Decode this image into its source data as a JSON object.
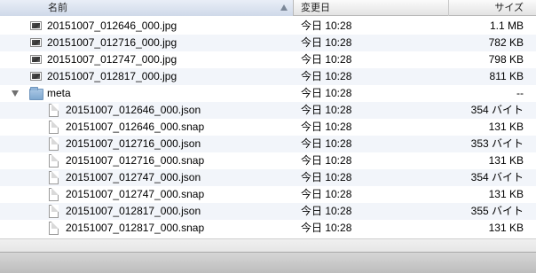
{
  "columns": {
    "name": "名前",
    "date": "変更日",
    "size": "サイズ"
  },
  "files": [
    {
      "name": "20151007_012646_000.jpg",
      "date": "今日 10:28",
      "size": "1.1 MB",
      "icon": "image-icon"
    },
    {
      "name": "20151007_012716_000.jpg",
      "date": "今日 10:28",
      "size": "782 KB",
      "icon": "image-icon"
    },
    {
      "name": "20151007_012747_000.jpg",
      "date": "今日 10:28",
      "size": "798 KB",
      "icon": "image-icon"
    },
    {
      "name": "20151007_012817_000.jpg",
      "date": "今日 10:28",
      "size": "811 KB",
      "icon": "image-icon"
    }
  ],
  "folder": {
    "name": "meta",
    "date": "今日 10:28",
    "size": "--",
    "icon": "folder-icon",
    "expanded": true
  },
  "meta_files": [
    {
      "name": "20151007_012646_000.json",
      "date": "今日 10:28",
      "size": "354 バイト",
      "icon": "document-icon"
    },
    {
      "name": "20151007_012646_000.snap",
      "date": "今日 10:28",
      "size": "131 KB",
      "icon": "document-icon"
    },
    {
      "name": "20151007_012716_000.json",
      "date": "今日 10:28",
      "size": "353 バイト",
      "icon": "document-icon"
    },
    {
      "name": "20151007_012716_000.snap",
      "date": "今日 10:28",
      "size": "131 KB",
      "icon": "document-icon"
    },
    {
      "name": "20151007_012747_000.json",
      "date": "今日 10:28",
      "size": "354 バイト",
      "icon": "document-icon"
    },
    {
      "name": "20151007_012747_000.snap",
      "date": "今日 10:28",
      "size": "131 KB",
      "icon": "document-icon"
    },
    {
      "name": "20151007_012817_000.json",
      "date": "今日 10:28",
      "size": "355 バイト",
      "icon": "document-icon"
    },
    {
      "name": "20151007_012817_000.snap",
      "date": "今日 10:28",
      "size": "131 KB",
      "icon": "document-icon"
    }
  ]
}
